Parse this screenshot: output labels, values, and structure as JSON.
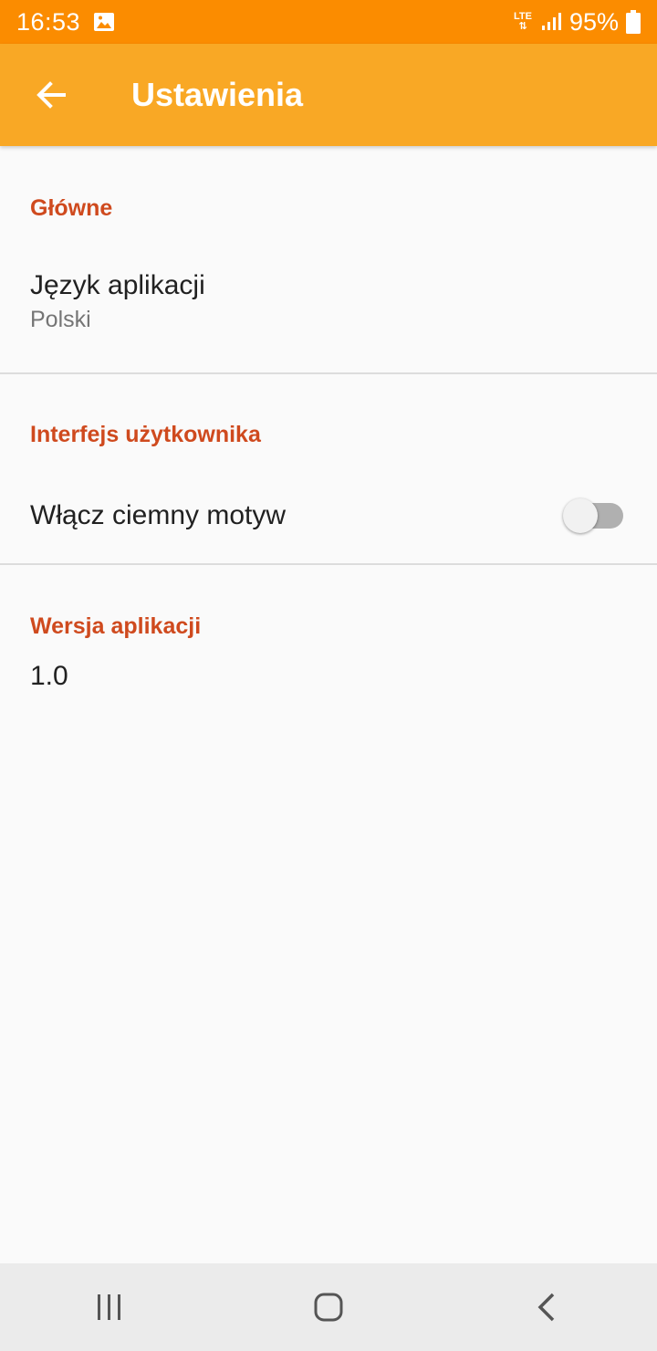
{
  "status_bar": {
    "time": "16:53",
    "network": "LTE",
    "battery": "95%",
    "background_color": "#fb8c00"
  },
  "app_bar": {
    "title": "Ustawienia",
    "back_icon": "arrow-left-icon",
    "background_color": "#f9a825"
  },
  "sections": [
    {
      "category": "Główne",
      "items": [
        {
          "title": "Język aplikacji",
          "summary": "Polski"
        }
      ]
    },
    {
      "category": "Interfejs użytkownika",
      "items": [
        {
          "title": "Włącz ciemny motyw",
          "switch_on": false
        }
      ]
    },
    {
      "category": "Wersja aplikacji",
      "items": [
        {
          "title": "1.0"
        }
      ]
    }
  ],
  "accent_color": "#cf4a1e",
  "nav_bar": {
    "buttons": [
      "recent-apps-icon",
      "home-icon",
      "back-icon"
    ]
  }
}
